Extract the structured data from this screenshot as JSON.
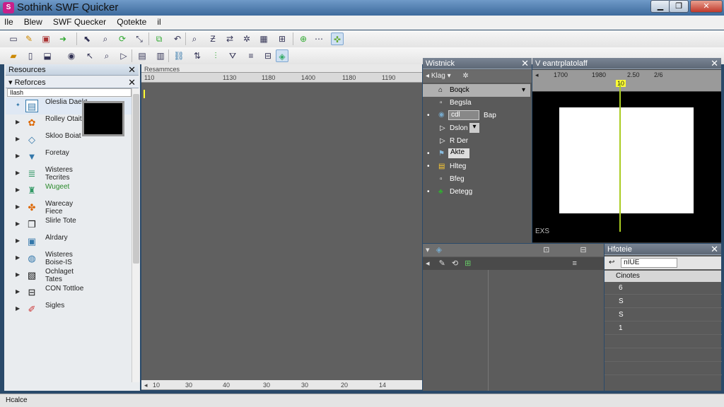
{
  "window": {
    "title": "Sothink SWF Quicker",
    "app_icon": "S"
  },
  "menu": [
    "Ile",
    "Blew",
    "SWF Quecker",
    "Qotekte",
    "il"
  ],
  "resources": {
    "panel_title": "Resources",
    "sub_title": "Reforces",
    "search": "Ilash",
    "items": [
      {
        "label": "Oleslia Daekt",
        "icon": "page-icon"
      },
      {
        "label": "Rolley Otait",
        "icon": "shapes-icon"
      },
      {
        "label": "Skloo Boiat",
        "icon": "diamond-icon"
      },
      {
        "label": "Foretay",
        "icon": "gem-icon"
      },
      {
        "label": "Wisteres Tecrites",
        "icon": "list-icon"
      },
      {
        "label": "Wugeet",
        "icon": "figure-icon"
      },
      {
        "label": "Warecay Fiece",
        "icon": "palette-icon"
      },
      {
        "label": "Slirle Tote",
        "icon": "doc-icon"
      },
      {
        "label": "Alrdary",
        "icon": "book-icon"
      },
      {
        "label": "Wisteres Boise-IS",
        "icon": "globe-icon"
      },
      {
        "label": "Ochlaget Tates",
        "icon": "sheet-icon"
      },
      {
        "label": "CON Tottloe",
        "icon": "table-icon"
      },
      {
        "label": "Sigles",
        "icon": "brush-icon"
      }
    ]
  },
  "document": {
    "tab_label": "Resammces",
    "ruler_top": [
      "110",
      "1130",
      "1180",
      "1400",
      "1180",
      "1190"
    ],
    "ruler_bottom": [
      "10",
      "30",
      "40",
      "30",
      "30",
      "20",
      "14"
    ]
  },
  "outline": {
    "title": "Wistnick",
    "toolbar_label": "Klag",
    "items": [
      {
        "label": "Boqck",
        "selected": true
      },
      {
        "label": "Begsla"
      },
      {
        "label": "cdl",
        "extra": "Bap"
      },
      {
        "label": "Dslon"
      },
      {
        "label": "R Der"
      },
      {
        "label": "Akte"
      },
      {
        "label": "Hlteg"
      },
      {
        "label": "Bfeg"
      },
      {
        "label": "Detegg"
      }
    ]
  },
  "preview": {
    "title": "V eantrplatolaff",
    "ruler": [
      "1700",
      "1980",
      "2.50",
      "2/6"
    ],
    "marker": "10",
    "coords": "EXS"
  },
  "properties": {
    "title": "Hfoteie",
    "field": "nIUE",
    "header": "Cinotes",
    "rows": [
      "6",
      "S",
      "S",
      "1"
    ]
  },
  "status": {
    "text": "Hcalce"
  }
}
